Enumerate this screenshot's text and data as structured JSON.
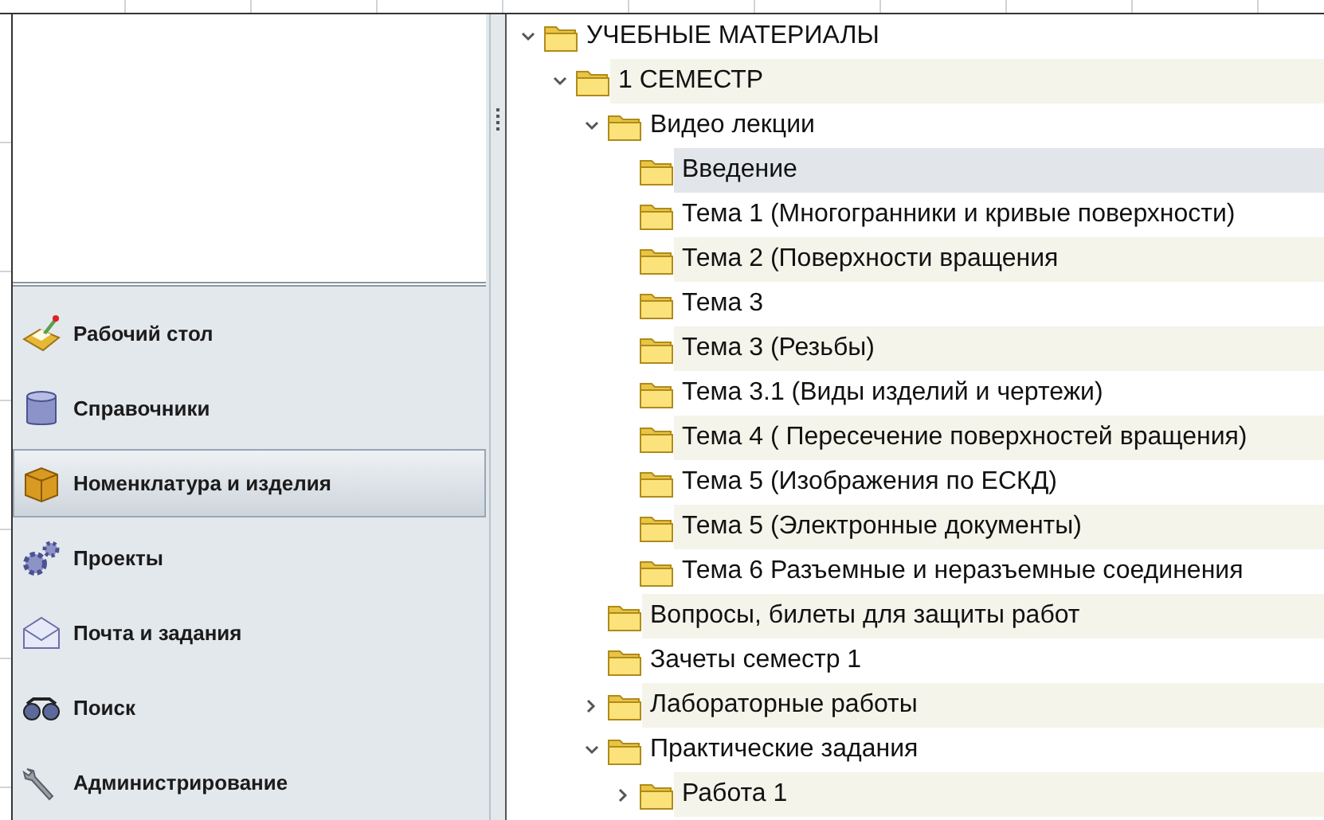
{
  "nav": [
    {
      "label": "Рабочий стол",
      "selected": false
    },
    {
      "label": "Справочники",
      "selected": false
    },
    {
      "label": "Номенклатура и изделия",
      "selected": true
    },
    {
      "label": "Проекты",
      "selected": false
    },
    {
      "label": "Почта и задания",
      "selected": false
    },
    {
      "label": "Поиск",
      "selected": false
    },
    {
      "label": "Администрирование",
      "selected": false
    }
  ],
  "tree": [
    {
      "label": "УЧЕБНЫЕ МАТЕРИАЛЫ",
      "selected": false,
      "expanded": true,
      "children": [
        {
          "label": "1  СЕМЕСТР",
          "selected": false,
          "expanded": true,
          "children": [
            {
              "label": "Видео лекции",
              "selected": false,
              "expanded": true,
              "children": [
                {
                  "label": "Введение",
                  "selected": true
                },
                {
                  "label": "Тема 1 (Многогранники и кривые поверхности)",
                  "selected": false
                },
                {
                  "label": "Тема 2 (Поверхности вращения",
                  "selected": false
                },
                {
                  "label": "Тема 3",
                  "selected": false
                },
                {
                  "label": "Тема 3 (Резьбы)",
                  "selected": false
                },
                {
                  "label": "Тема 3.1 (Виды изделий и чертежи)",
                  "selected": false
                },
                {
                  "label": "Тема 4 ( Пересечение поверхностей вращения)",
                  "selected": false
                },
                {
                  "label": "Тема 5 (Изображения по ЕСКД)",
                  "selected": false
                },
                {
                  "label": "Тема 5 (Электронные документы)",
                  "selected": false
                },
                {
                  "label": "Тема 6 Разъемные и неразъемные соединения",
                  "selected": false
                }
              ]
            },
            {
              "label": "Вопросы, билеты для защиты работ",
              "selected": false
            },
            {
              "label": "Зачеты семестр 1",
              "selected": false
            },
            {
              "label": "Лабораторные работы",
              "selected": false,
              "expanded": false
            },
            {
              "label": "Практические задания",
              "selected": false,
              "expanded": true,
              "children": [
                {
                  "label": "Работа 1",
                  "selected": false,
                  "expanded": false
                }
              ]
            }
          ]
        }
      ]
    }
  ]
}
